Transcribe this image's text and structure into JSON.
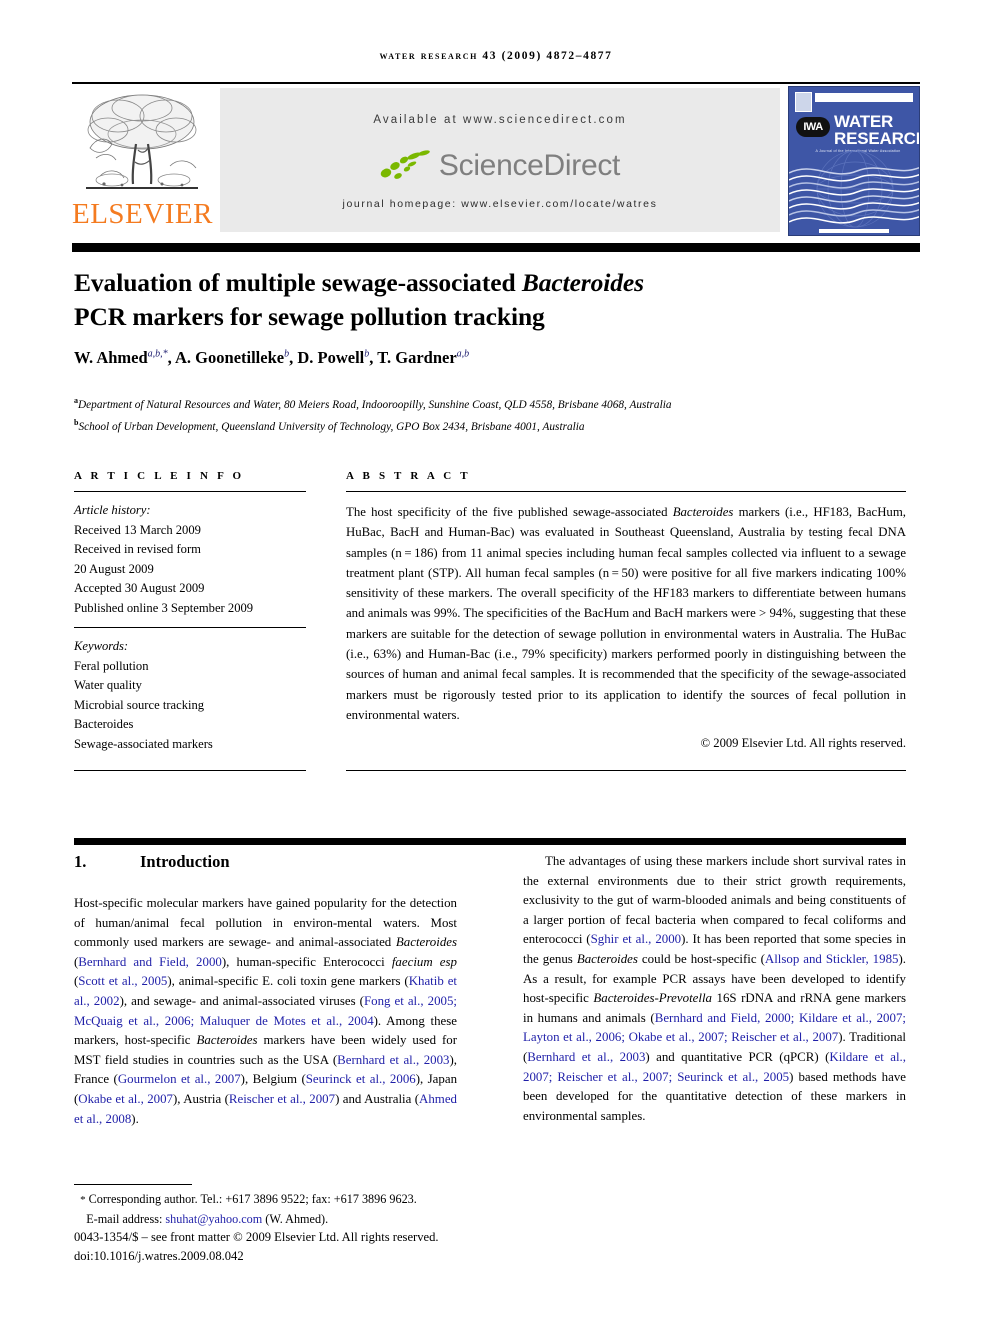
{
  "running_head": "Water Research 43 (2009) 4872–4877",
  "masthead": {
    "publisher_name": "ELSEVIER",
    "available_at": "Available at www.sciencedirect.com",
    "sciencedirect_word": "ScienceDirect",
    "journal_homepage": "journal homepage: www.elsevier.com/locate/watres",
    "cover": {
      "iwa_label": "IWA",
      "title_line1": "WATER",
      "title_line2": "RESEARCH",
      "subtitle": "A Journal of the International Water Association"
    },
    "colors": {
      "elsevier_orange": "#F47B20",
      "sciencedirect_green": "#7AB800",
      "sciencedirect_gray": "#7F7F7F",
      "cover_blue": "#3E56A6",
      "citation_blue": "#1F1FA8",
      "panel_gray": "#EAEAEA"
    }
  },
  "article": {
    "title_line1_pre": "Evaluation of multiple sewage-associated ",
    "title_line1_italic": "Bacteroides",
    "title_line2": "PCR markers for sewage pollution tracking",
    "authors": [
      {
        "name": "W. Ahmed",
        "marks": "a,b,*"
      },
      {
        "name": "A. Goonetilleke",
        "marks": "b"
      },
      {
        "name": "D. Powell",
        "marks": "b"
      },
      {
        "name": "T. Gardner",
        "marks": "a,b"
      }
    ],
    "affiliations": [
      {
        "mark": "a",
        "text": "Department of Natural Resources and Water, 80 Meiers Road, Indooroopilly, Sunshine Coast, QLD 4558, Brisbane 4068, Australia"
      },
      {
        "mark": "b",
        "text": "School of Urban Development, Queensland University of Technology, GPO Box 2434, Brisbane 4001, Australia"
      }
    ]
  },
  "article_info": {
    "heading": "A R T I C L E  I N F O",
    "history_label": "Article history:",
    "history": [
      "Received 13 March 2009",
      "Received in revised form",
      "20 August 2009",
      "Accepted 30 August 2009",
      "Published online 3 September 2009"
    ],
    "keywords_label": "Keywords:",
    "keywords": [
      "Feral pollution",
      "Water quality",
      "Microbial source tracking",
      "Bacteroides",
      "Sewage-associated markers"
    ]
  },
  "abstract": {
    "heading": "A B S T R A C T",
    "p1_a": "The host specificity of the five published sewage-associated ",
    "p1_italic": "Bacteroides",
    "p1_b": " markers (i.e., HF183, BacHum, HuBac, BacH and Human-Bac) was evaluated in Southeast Queensland, Australia by testing fecal DNA samples (n = 186) from 11 animal species including human fecal samples collected via influent to a sewage treatment plant (STP). All human fecal samples (n = 50) were positive for all five markers indicating 100% sensitivity of these markers. The overall specificity of the HF183 markers to differentiate between humans and animals was 99%. The specificities of the BacHum and BacH markers were > 94%, suggesting that these markers are suitable for the detection of sewage pollution in environmental waters in Australia. The HuBac (i.e., 63%) and Human-Bac (i.e., 79% specificity) markers performed poorly in distinguishing between the sources of human and animal fecal samples. It is recommended that the specificity of the sewage-associated markers must be rigorously tested prior to its application to identify the sources of fecal pollution in environmental waters.",
    "copyright": "© 2009 Elsevier Ltd. All rights reserved."
  },
  "introduction": {
    "number": "1.",
    "heading": "Introduction",
    "left_p1_1": "Host-specific molecular markers have gained popularity for the detection of human/animal fecal pollution in environ-mental waters. Most commonly used markers are sewage- and animal-associated ",
    "left_p1_italic1": "Bacteroides",
    "left_p1_2": " (",
    "left_cite1": "Bernhard and Field, 2000",
    "left_p1_3": "), human-specific Enterococci ",
    "left_p1_italic2": "faecium esp",
    "left_p1_4": " (",
    "left_cite2": "Scott et al., 2005",
    "left_p1_5": "), animal-specific E. coli toxin gene markers (",
    "left_cite3": "Khatib et al., 2002",
    "left_p1_6": "), and sewage- and animal-associated viruses (",
    "left_cite4": "Fong et al., 2005; McQuaig et al., 2006; Maluquer de Motes et al., 2004",
    "left_p1_7": "). Among these markers, host-specific ",
    "left_p1_italic3": "Bacteroides",
    "left_p1_8": " markers have been widely used for MST field studies in countries such as the USA (",
    "left_cite5": "Bernhard et al., 2003",
    "left_p1_9": "), France (",
    "left_cite6": "Gourmelon et al., 2007",
    "left_p1_10": "), Belgium (",
    "left_cite7": "Seurinck et al., 2006",
    "left_p1_11": "), Japan (",
    "left_cite8": "Okabe et al., 2007",
    "left_p1_12": "), Austria (",
    "left_cite9": "Reischer et al., 2007",
    "left_p1_13": ") and Australia (",
    "left_cite10": "Ahmed et al., 2008",
    "left_p1_14": ").",
    "right_p1_1": "The advantages of using these markers include short survival rates in the external environments due to their strict growth requirements, exclusivity to the gut of warm-blooded animals and being constituents of a larger portion of fecal bacteria when compared to fecal coliforms and enterococci (",
    "right_cite1": "Sghir et al., 2000",
    "right_p1_2": "). It has been reported that some species in the genus ",
    "right_p1_italic1": "Bacteroides",
    "right_p1_3": " could be host-specific (",
    "right_cite2": "Allsop and Stickler, 1985",
    "right_p1_4": "). As a result, for example PCR assays have been developed to identify host-specific ",
    "right_p1_italic2": "Bacteroides-Prevotella",
    "right_p1_5": " 16S rDNA and rRNA gene markers in humans and animals (",
    "right_cite3": "Bernhard and Field, 2000; Kildare et al., 2007; Layton et al., 2006; Okabe et al., 2007; Reischer et al., 2007",
    "right_p1_6": "). Traditional (",
    "right_cite4": "Bernhard et al., 2003",
    "right_p1_7": ") and quantitative PCR (qPCR) (",
    "right_cite5": "Kildare et al., 2007; Reischer et al., 2007; Seurinck et al., 2005",
    "right_p1_8": ") based methods have been developed for the quantitative detection of these markers in environmental samples."
  },
  "footer": {
    "corresponding_mark": "*",
    "corresponding": "Corresponding author. Tel.: +617 3896 9522; fax: +617 3896 9623.",
    "email_label": "E-mail address: ",
    "email": "shuhat@yahoo.com",
    "email_suffix": " (W. Ahmed).",
    "issn_line": "0043-1354/$ – see front matter © 2009 Elsevier Ltd. All rights reserved.",
    "doi_line": "doi:10.1016/j.watres.2009.08.042"
  }
}
